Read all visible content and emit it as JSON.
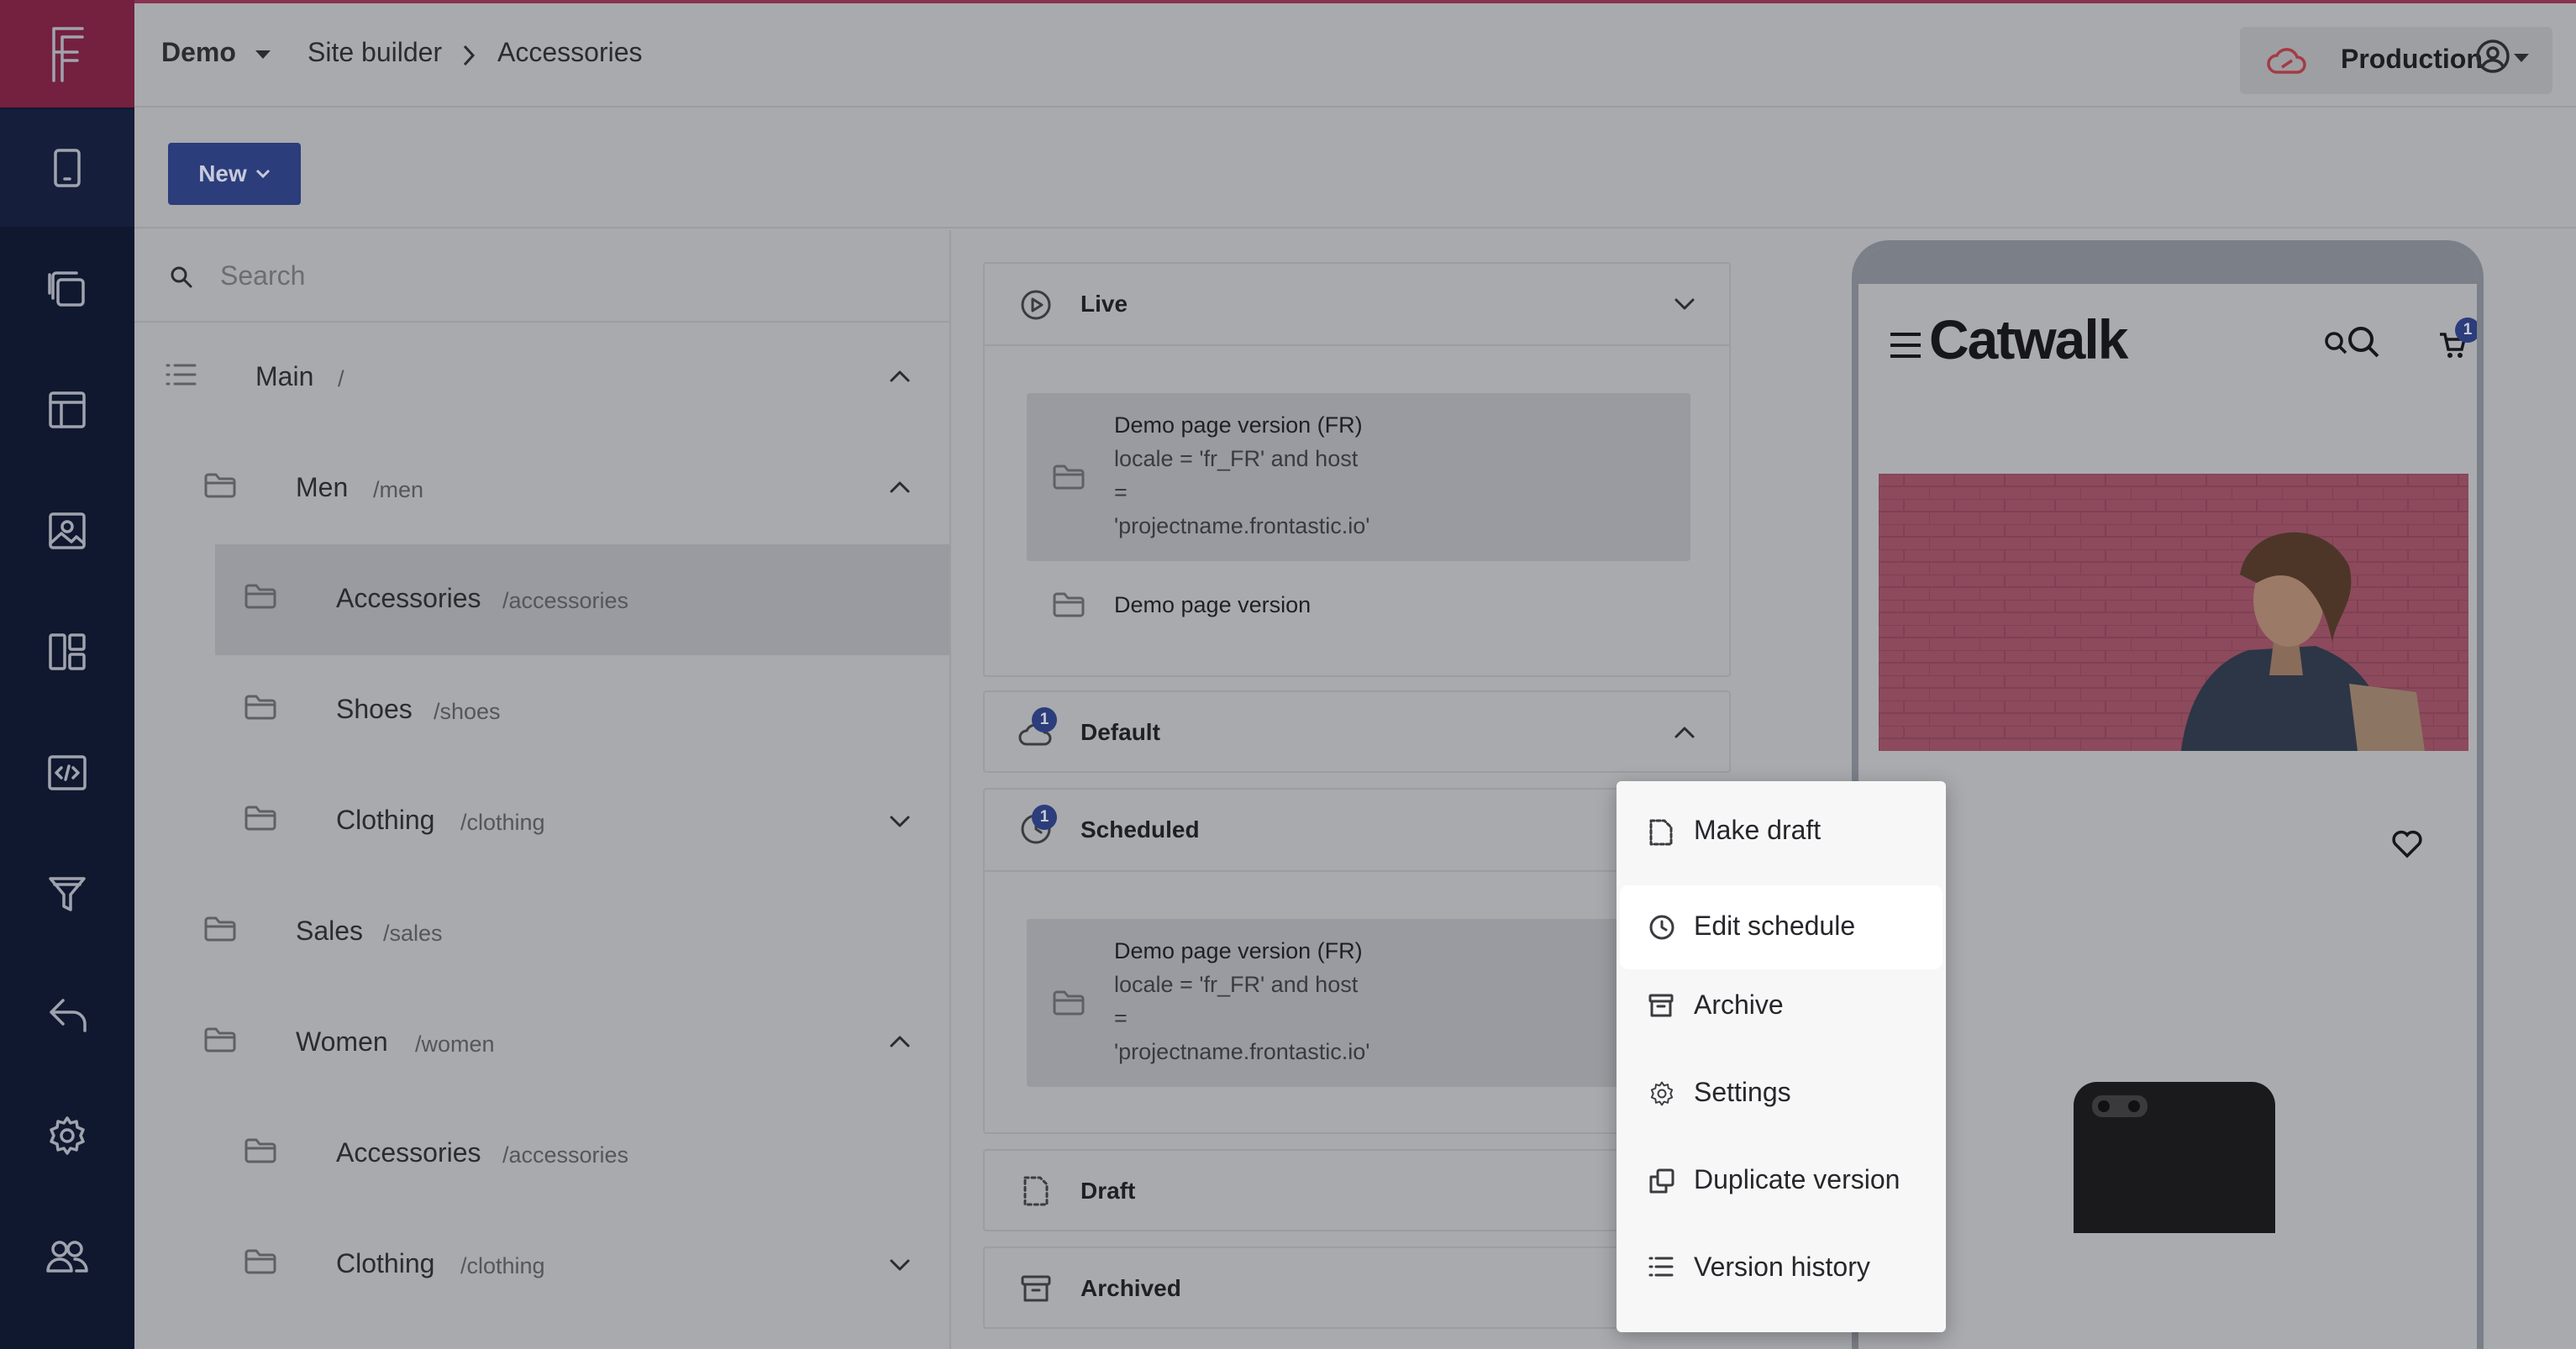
{
  "window": {
    "accent": "#8a3350",
    "overlay": "#a9aaae"
  },
  "header": {
    "project": "Demo",
    "breadcrumb": [
      "Site builder",
      "Accessories"
    ],
    "environment": "Production"
  },
  "toolbar": {
    "new_label": "New"
  },
  "rail": {
    "items": [
      "logo-icon",
      "device-icon",
      "pages-icon",
      "layout-icon",
      "image-icon",
      "components-icon",
      "code-icon",
      "filter-icon",
      "undo-icon",
      "gear-icon",
      "users-icon"
    ]
  },
  "tree": {
    "search_placeholder": "Search",
    "nodes": [
      {
        "label": "Main",
        "path": "/"
      },
      {
        "label": "Men",
        "path": "/men"
      },
      {
        "label": "Accessories",
        "path": "/accessories"
      },
      {
        "label": "Shoes",
        "path": "/shoes"
      },
      {
        "label": "Clothing",
        "path": "/clothing"
      },
      {
        "label": "Sales",
        "path": "/sales"
      },
      {
        "label": "Women",
        "path": "/women"
      },
      {
        "label": "Accessories",
        "path": "/accessories"
      },
      {
        "label": "Clothing",
        "path": "/clothing"
      }
    ]
  },
  "versions": {
    "live": {
      "title": "Live",
      "items": [
        {
          "title": "Demo page version (FR)",
          "condition": "locale = 'fr_FR' and host\n=\n'projectname.frontastic.io'"
        },
        {
          "title": "Demo page version"
        }
      ]
    },
    "default": {
      "title": "Default",
      "badge": "1"
    },
    "scheduled": {
      "title": "Scheduled",
      "badge": "1",
      "items": [
        {
          "title": "Demo page version (FR)",
          "condition": "locale = 'fr_FR' and host\n=\n'projectname.frontastic.io'"
        }
      ]
    },
    "draft": {
      "title": "Draft"
    },
    "archived": {
      "title": "Archived"
    }
  },
  "preview": {
    "brand": "Catwalk",
    "cart_count": "1"
  },
  "context_menu": {
    "items": [
      {
        "label": "Make draft",
        "icon": "draft-icon"
      },
      {
        "label": "Edit schedule",
        "icon": "clock-icon"
      },
      {
        "label": "Archive",
        "icon": "archive-icon"
      },
      {
        "label": "Settings",
        "icon": "gear-icon"
      },
      {
        "label": "Duplicate version",
        "icon": "duplicate-icon"
      },
      {
        "label": "Version history",
        "icon": "list-icon"
      }
    ]
  }
}
